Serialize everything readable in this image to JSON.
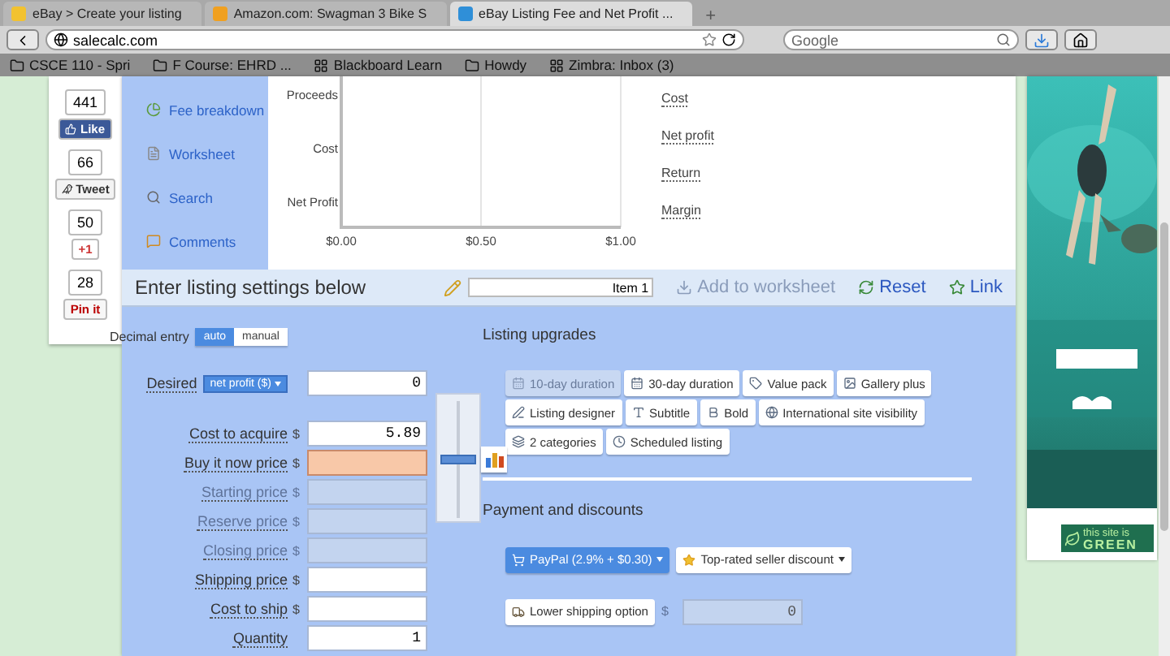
{
  "browser": {
    "tabs": [
      {
        "label": "eBay > Create your listing",
        "selected": false
      },
      {
        "label": "Amazon.com: Swagman 3 Bike S",
        "selected": false
      },
      {
        "label": "eBay Listing Fee and Net Profit ...",
        "selected": true
      }
    ],
    "new_tab": "+",
    "address": "salecalc.com",
    "search_placeholder": "Google",
    "bookmarks": [
      "CSCE 110 - Spri",
      "F Course: EHRD ...",
      "Blackboard Learn",
      "Howdy",
      "Zimbra: Inbox (3)"
    ]
  },
  "social": [
    {
      "kind": "facebook",
      "count": "441",
      "label": "Like"
    },
    {
      "kind": "twitter",
      "count": "66",
      "label": "Tweet"
    },
    {
      "kind": "google",
      "count": "50",
      "label": "+1"
    },
    {
      "kind": "pinterest",
      "count": "28",
      "label": "Pin it"
    }
  ],
  "nav": [
    "Fee breakdown",
    "Worksheet",
    "Search",
    "Comments"
  ],
  "chart": {
    "chart_data": {
      "type": "bar",
      "orientation": "horizontal",
      "categories": [
        "Proceeds",
        "Cost",
        "Net Profit"
      ],
      "values": [
        0,
        0,
        0
      ],
      "xlim": [
        0,
        1
      ],
      "xticks": [
        {
          "value": 0,
          "label": "$0.00"
        },
        {
          "value": 0.5,
          "label": "$0.50"
        },
        {
          "value": 1,
          "label": "$1.00"
        }
      ]
    }
  },
  "summary": [
    "Cost",
    "Net profit",
    "Return",
    "Margin"
  ],
  "listing_bar": {
    "title": "Enter listing settings below",
    "item_name": "Item 1",
    "actions": [
      {
        "kind": "add",
        "label": "Add to worksheet",
        "disabled": true
      },
      {
        "kind": "reset",
        "label": "Reset",
        "disabled": false
      },
      {
        "kind": "link",
        "label": "Link",
        "disabled": false
      }
    ]
  },
  "decimal_entry": {
    "label": "Decimal entry",
    "options": [
      {
        "label": "auto",
        "selected": true
      },
      {
        "label": "manual",
        "selected": false
      }
    ]
  },
  "fields": [
    {
      "label": "Desired",
      "dropdown": "net profit ($)",
      "value": "0",
      "disabled": false,
      "invalid": false
    },
    {
      "label": "Cost to acquire",
      "currency": "$",
      "value": "5.89",
      "disabled": false,
      "invalid": false
    },
    {
      "label": "Buy it now price",
      "currency": "$",
      "disabled": false,
      "invalid": true
    },
    {
      "label": "Starting price",
      "currency": "$",
      "disabled": true,
      "invalid": false
    },
    {
      "label": "Reserve price",
      "currency": "$",
      "disabled": true,
      "invalid": false
    },
    {
      "label": "Closing price",
      "currency": "$",
      "disabled": true,
      "invalid": false
    },
    {
      "label": "Shipping price",
      "currency": "$",
      "disabled": false,
      "invalid": false
    },
    {
      "label": "Cost to ship",
      "currency": "$",
      "disabled": false,
      "invalid": false
    },
    {
      "label": "Quantity",
      "value": "1",
      "disabled": false,
      "invalid": false
    }
  ],
  "slider": {
    "level": 0.5
  },
  "upgrades": {
    "title": "Listing upgrades",
    "items": [
      {
        "label": "10-day duration",
        "disabled": true
      },
      {
        "label": "30-day duration",
        "disabled": false
      },
      {
        "label": "Value pack",
        "disabled": false
      },
      {
        "label": "Gallery plus",
        "disabled": false
      },
      {
        "label": "Listing designer",
        "disabled": false
      },
      {
        "label": "Subtitle",
        "disabled": false
      },
      {
        "label": "Bold",
        "disabled": false
      },
      {
        "label": "International site visibility",
        "disabled": false
      },
      {
        "label": "2 categories",
        "disabled": false
      },
      {
        "label": "Scheduled listing",
        "disabled": false
      }
    ]
  },
  "payment": {
    "title": "Payment and discounts",
    "options": [
      {
        "label": "PayPal (2.9% + $0.30)",
        "selected": true
      },
      {
        "label": "Top-rated seller discount",
        "selected": false
      }
    ],
    "lower_shipping": {
      "label": "Lower shipping option",
      "currency": "$",
      "value": "0",
      "disabled": true
    }
  },
  "ad": {
    "kind": "picture"
  },
  "badge": {
    "line1": "this site is",
    "line2": "GREEN"
  }
}
